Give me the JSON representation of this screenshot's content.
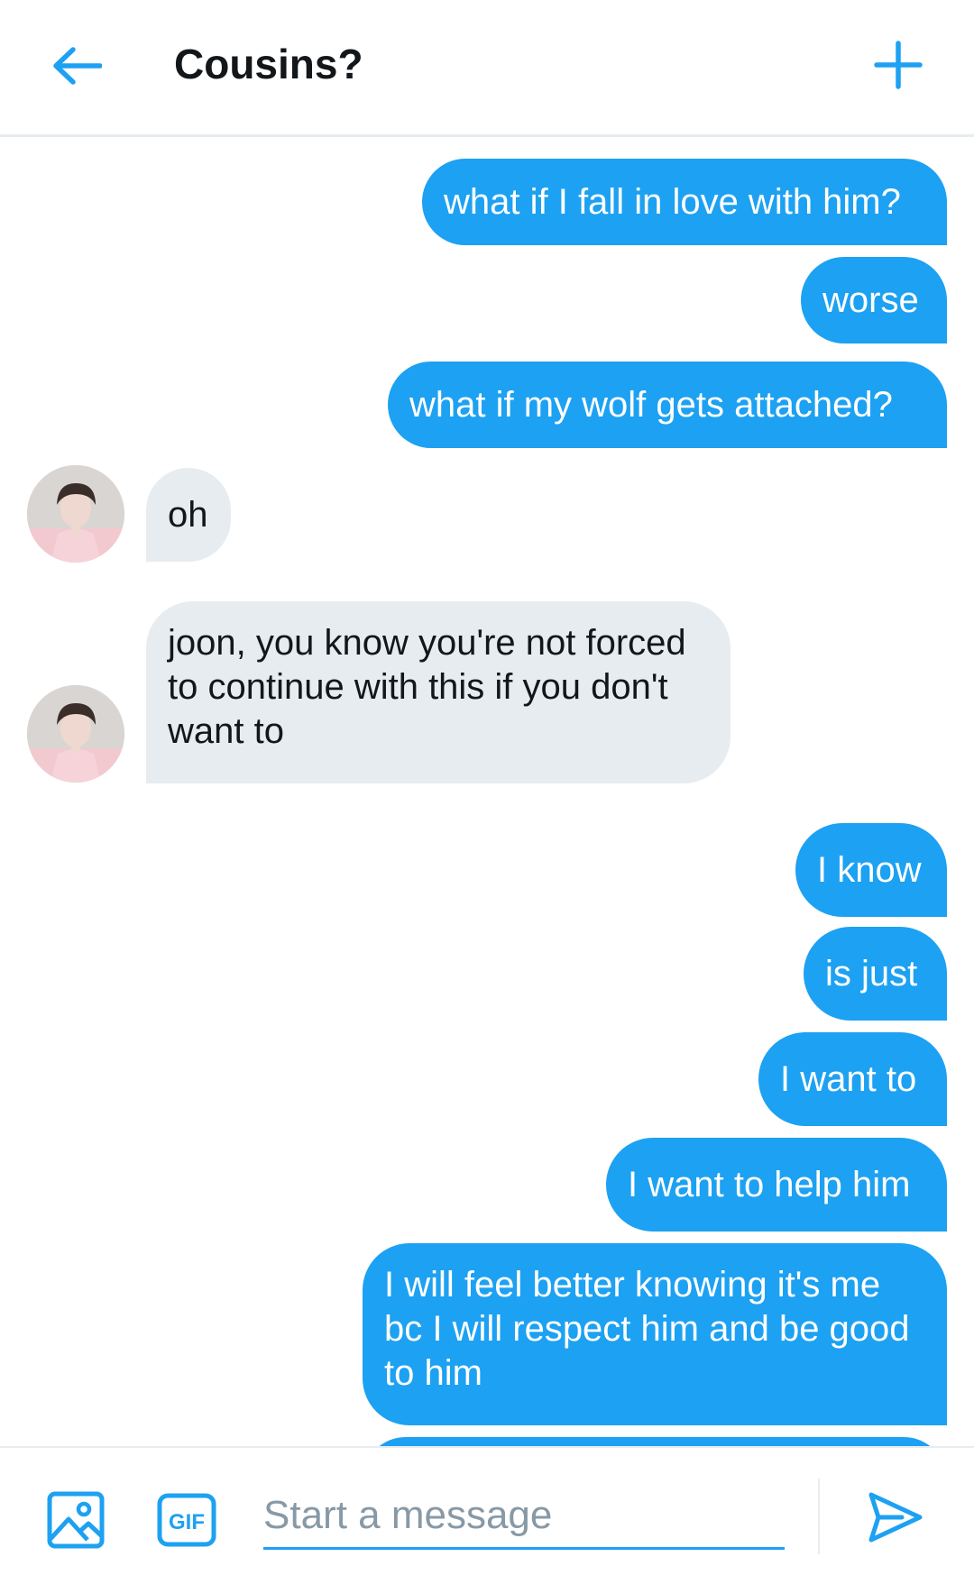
{
  "header": {
    "title": "Cousins?"
  },
  "colors": {
    "accent": "#1da1f2",
    "incoming_bubble": "#e6ecf0",
    "text": "#14171a"
  },
  "messages": [
    {
      "from": "me",
      "text": "what if I fall in love with him?"
    },
    {
      "from": "me",
      "text": "worse"
    },
    {
      "from": "me",
      "text": "what if my wolf gets attached?"
    },
    {
      "from": "them",
      "text": "oh"
    },
    {
      "from": "them",
      "text": "joon, you know you're not forced to continue with this if you don't want to"
    },
    {
      "from": "me",
      "text": "I know"
    },
    {
      "from": "me",
      "text": "is just"
    },
    {
      "from": "me",
      "text": "I want to"
    },
    {
      "from": "me",
      "text": "I want to help him"
    },
    {
      "from": "me",
      "text": "I will feel better knowing it's me bc I will respect him and be good to him"
    }
  ],
  "composer": {
    "placeholder": "Start a message",
    "gif_label": "GIF"
  },
  "icons": {
    "back": "arrow-left-icon",
    "new": "plus-icon",
    "media": "image-icon",
    "gif": "gif-icon",
    "send": "send-icon"
  }
}
